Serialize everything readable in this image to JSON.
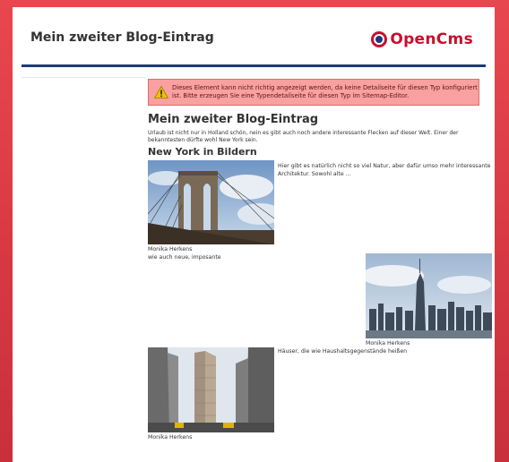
{
  "header": {
    "site_title": "Mein zweiter Blog-Eintrag",
    "logo_text": "OpenCms"
  },
  "warning": {
    "text": "Dieses Element kann nicht richtig angezeigt werden, da keine Detailseite für diesen Typ konfiguriert ist. Bitte erzeugen Sie eine Typendetailseite für diesen Typ im Sitemap-Editor."
  },
  "article": {
    "title": "Mein zweiter Blog-Eintrag",
    "intro": "Urlaub ist nicht nur in Holland schön, nein es gibt auch noch andere interessante Flecken auf dieser Welt. Einer der bekanntesten dürfte wohl New York sein.",
    "section_title": "New York in Bildern",
    "paragraphs": {
      "p1": "Hier gibt es natürlich nicht so viel Natur, aber dafür umso mehr interessante Architektur. Sowohl alte ...",
      "p2": "wie auch neue, imposante",
      "p3": "Häuser, die wie Haushaltsgegenstände heißen"
    },
    "images": [
      {
        "subject": "brooklyn-bridge",
        "caption": "Monika Herkens"
      },
      {
        "subject": "manhattan-skyline",
        "caption": "Monika Herkens"
      },
      {
        "subject": "flatiron-building",
        "caption": "Monika Herkens"
      }
    ]
  },
  "colors": {
    "frame": "#d93a44",
    "header_rule": "#1b3a7a",
    "warning_bg": "#f9a0a0",
    "brand": "#c8102e"
  }
}
